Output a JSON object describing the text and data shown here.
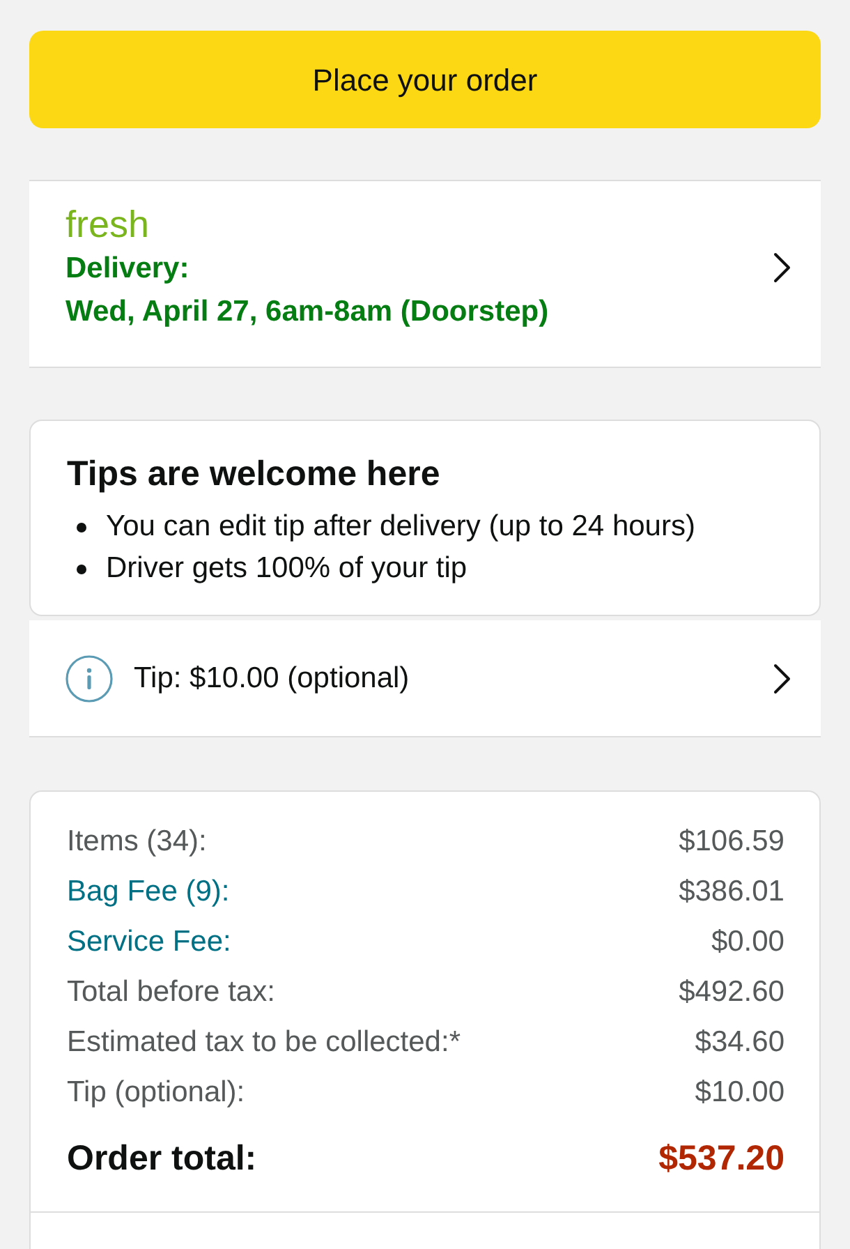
{
  "primary_button": {
    "label": "Place your order"
  },
  "delivery": {
    "brand": "fresh",
    "label": "Delivery:",
    "slot": "Wed, April 27, 6am-8am (Doorstep)"
  },
  "tips_notice": {
    "title": "Tips are welcome here",
    "bullets": [
      "You can edit tip after delivery (up to 24 hours)",
      "Driver gets 100% of your tip"
    ]
  },
  "tip_row": {
    "text": "Tip: $10.00 (optional)"
  },
  "summary": {
    "rows": [
      {
        "kind": "plain",
        "label": "Items (34):",
        "amount": "$106.59"
      },
      {
        "kind": "link",
        "label": "Bag Fee (9):",
        "amount": "$386.01"
      },
      {
        "kind": "link",
        "label": "Service Fee:",
        "amount": "$0.00"
      },
      {
        "kind": "plain",
        "label": "Total before tax:",
        "amount": "$492.60"
      },
      {
        "kind": "plain",
        "label": "Estimated tax to be collected:*",
        "amount": "$34.60"
      },
      {
        "kind": "plain",
        "label": "Tip (optional):",
        "amount": "$10.00"
      }
    ],
    "total": {
      "label": "Order total:",
      "amount": "$537.20"
    }
  }
}
